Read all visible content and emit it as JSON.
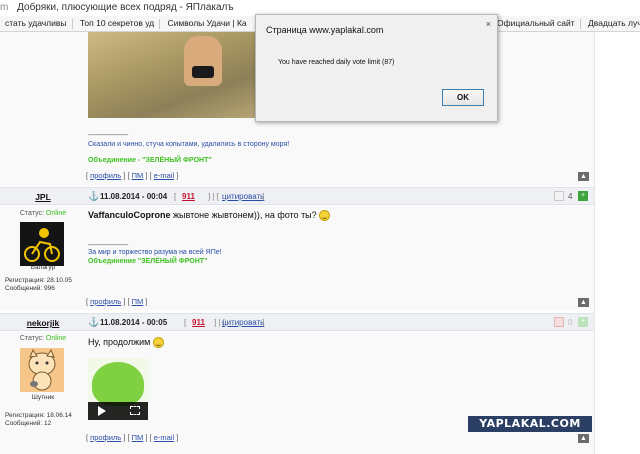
{
  "browser": {
    "domain_fragment": "m",
    "tab_title": "Добряки, плюсующие всех подряд - ЯПлакалъ",
    "bookmarks": [
      "стать удачливы",
      "Топ 10 секретов уд",
      "Символы Удачи | Ка",
      "Официальный сайт",
      "Двадцать лучши"
    ]
  },
  "dialog": {
    "title": "Страница www.yaplakal.com",
    "close_glyph": "×",
    "message": "You have reached daily vote limit (87)",
    "ok_label": "OK"
  },
  "post0": {
    "sig_line": "--------------------",
    "sig_text": "Сказали и чинно, стуча копытами, удалились в сторону моря!",
    "sig_group": "Объединение - \"ЗЕЛЁНЫЙ ФРОНТ\"",
    "actions": [
      "профиль",
      "ПМ",
      "e-mail"
    ]
  },
  "post1": {
    "username": "JPL",
    "date": "11.08.2014 - 00:04",
    "number": "911",
    "quote": "цитировать",
    "status_label": "Статус:",
    "status_value": "Online",
    "rank": "Балагур",
    "reg": "Регистрация: 28.10.05",
    "msgs": "Сообщений: 996",
    "text_bold": "VaffanculoCoprone",
    "text_rest": " жывтоне жывтонем)), на фото ты?",
    "sig_line": "--------------------",
    "sig_text": "За мир и торжество разума на всей ЯПе!",
    "sig_group": "Объединение \"ЗЕЛЁНЫЙ ФРОНТ\"",
    "votes": "4",
    "actions": [
      "профиль",
      "ПМ"
    ]
  },
  "post2": {
    "username": "nekorjik",
    "date": "11.08.2014 - 00:05",
    "number": "911",
    "quote": "цитировать",
    "status_label": "Статус:",
    "status_value": "Online",
    "rank": "Шутник",
    "reg": "Регистрация: 18.06.14",
    "msgs": "Сообщений: 12",
    "text": "Ну, продолжим",
    "votes": "0",
    "actions": [
      "профиль",
      "ПМ",
      "e-mail"
    ]
  },
  "watermark": "YAPLAKAL.COM",
  "colors": {
    "accent_green": "#3ec021",
    "link_blue": "#2a4da8",
    "post_num_red": "#c8102e",
    "watermark_bg": "#2a3f63"
  },
  "icons": [
    "anchor-icon",
    "smiley-icon",
    "vote-minus-icon",
    "vote-plus-icon",
    "top-arrow-icon",
    "play-icon",
    "fullscreen-icon"
  ]
}
